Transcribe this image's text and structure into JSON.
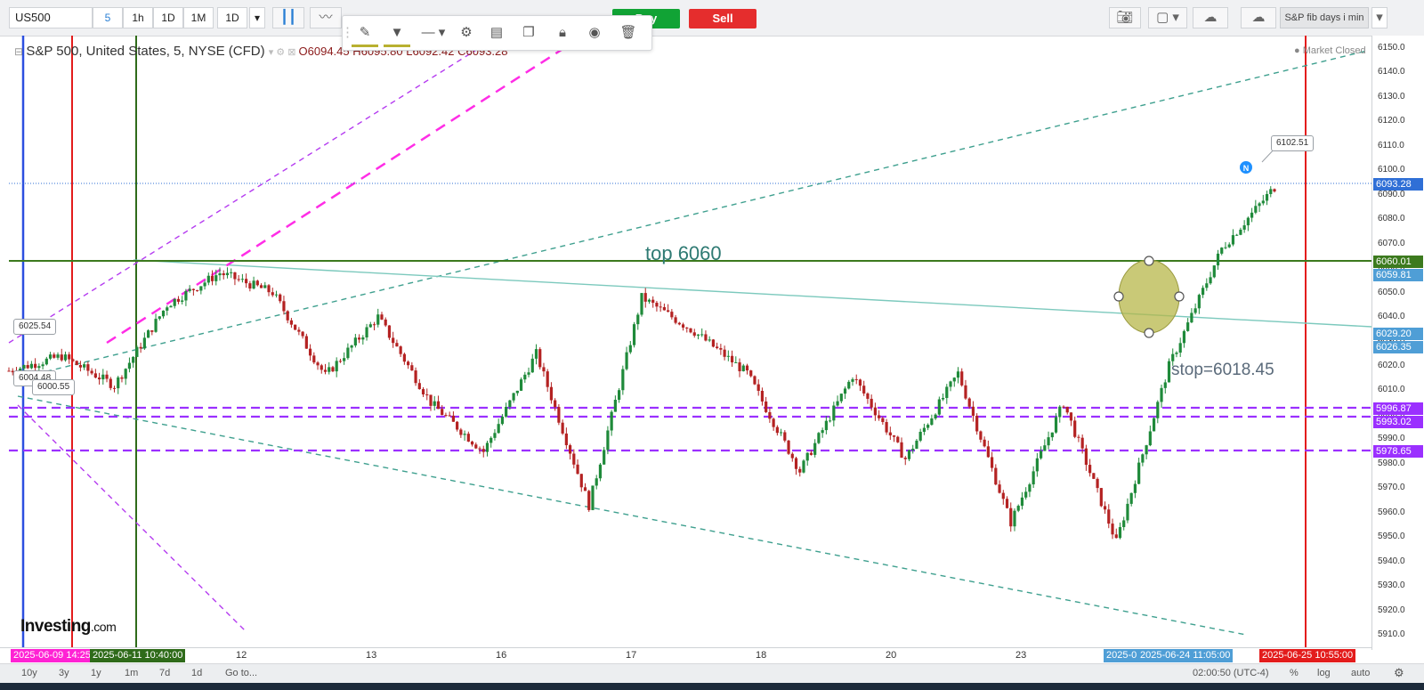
{
  "toolbar": {
    "symbol": "US500",
    "intervals": [
      "5",
      "1h",
      "1D",
      "1M",
      "1D"
    ],
    "buy_label": "Buy",
    "sell_label": "Sell",
    "layout_name": "S&P fib days i min",
    "icons": [
      "candles-icon",
      "line-chart-icon",
      "camera-icon",
      "color-box-icon",
      "cloud-download-icon",
      "cloud-upload-icon",
      "dropdown-caret-icon"
    ]
  },
  "drawing_toolbar": {
    "icons": [
      "pencil-icon",
      "fill-bucket-icon",
      "line-style-icon",
      "settings-gear-icon",
      "layers-icon",
      "clone-icon",
      "lock-icon",
      "eye-icon",
      "trash-icon"
    ]
  },
  "header": {
    "title": "S&P 500, United States, 5, NYSE (CFD)",
    "open": "O6094.45",
    "high": "H6095.80",
    "low": "L6092.42",
    "close": "C6093.28",
    "market_status": "Market Closed"
  },
  "annotations": {
    "top_label": "top 6060",
    "stop_label": "stop=6018.45",
    "callouts": [
      "6025.54",
      "6004.48",
      "6000.55",
      "6102.51"
    ],
    "badge": "N"
  },
  "chart_data": {
    "type": "line",
    "symbol": "S&P 500",
    "timeframe": "5",
    "ylim": [
      5905,
      6155
    ],
    "y_ticks": [
      5910,
      5920,
      5930,
      5940,
      5950,
      5960,
      5970,
      5980,
      5990,
      6000,
      6010,
      6020,
      6030,
      6040,
      6050,
      6060,
      6070,
      6080,
      6090,
      6100,
      6110,
      6120,
      6130,
      6140,
      6150
    ],
    "x_ticks": [
      "12",
      "13",
      "16",
      "17",
      "18",
      "20",
      "23"
    ],
    "series": [
      {
        "x": [
          "06-09",
          "06-10",
          "06-10",
          "06-11",
          "06-11",
          "06-11",
          "06-12",
          "06-12",
          "06-13",
          "06-13",
          "06-13",
          "06-16",
          "06-16",
          "06-17",
          "06-17",
          "06-18",
          "06-18",
          "06-20",
          "06-20",
          "06-23",
          "06-23",
          "06-24",
          "06-24",
          "06-24",
          "06-25"
        ],
        "values": [
          6018,
          6024,
          6012,
          6045,
          6058,
          6050,
          6016,
          6040,
          6005,
          5985,
          6025,
          5963,
          6048,
          6034,
          6017,
          5977,
          6016,
          5982,
          6017,
          5956,
          6005,
          5948,
          6020,
          6068,
          6093
        ]
      }
    ],
    "price_levels": [
      "6093.28",
      "6060.01",
      "6059.81",
      "6029.20",
      "6026.35",
      "5996.87",
      "5993.02",
      "5978.65"
    ],
    "level_colors": {
      "current": "#2f6fd6",
      "top": "#3c7a1e",
      "channel": "#3fa08f",
      "stop": "#4f9ed6",
      "support": "#9b30ff"
    },
    "time_tags": [
      "2025-06-09 14:25",
      "2025-06-11 10:40:00",
      "2025-0",
      "2025-06-24 11:05:00",
      "2025-06-25 10:55:00"
    ],
    "grid": false
  },
  "bottombar": {
    "ranges": [
      "10y",
      "3y",
      "1y",
      "1m",
      "7d",
      "1d",
      "Go to..."
    ],
    "clock": "02:00:50 (UTC-4)",
    "options": [
      "%",
      "log",
      "auto"
    ]
  },
  "logo": {
    "brand": "Investing",
    "suffix": ".com"
  }
}
